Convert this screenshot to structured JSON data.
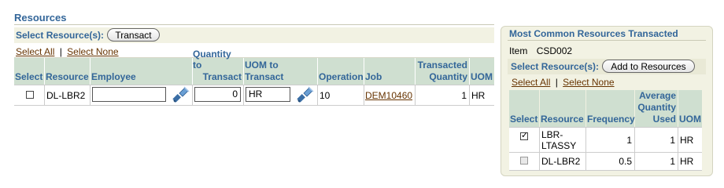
{
  "resources": {
    "title": "Resources",
    "select_label": "Select Resource(s):",
    "transact_button": "Transact",
    "select_all": "Select All",
    "separator": "|",
    "select_none": "Select None",
    "columns": {
      "select": "Select",
      "resource": "Resource",
      "employee": "Employee",
      "quantity_1": "Quantity to",
      "quantity_2": "Transact",
      "uom_1": "UOM to",
      "uom_2": "Transact",
      "operation": "Operation",
      "job": "Job",
      "transacted_1": "Transacted",
      "transacted_2": "Quantity",
      "uom": "UOM"
    },
    "row": {
      "checked": false,
      "resource": "DL-LBR2",
      "employee": "",
      "quantity": "0",
      "uom_to_transact": "HR",
      "operation": "10",
      "job": "DEM10460",
      "transacted_quantity": "1",
      "uom": "HR"
    },
    "icons": [
      "flashlight-search-icon",
      "flashlight-search-icon"
    ]
  },
  "most_common": {
    "title": "Most Common Resources Transacted",
    "item_label": "Item",
    "item_value": "CSD002",
    "select_label": "Select Resource(s):",
    "add_button": "Add to Resources",
    "select_all": "Select All",
    "separator": "|",
    "select_none": "Select None",
    "columns": {
      "select": "Select",
      "resource": "Resource",
      "frequency": "Frequency",
      "avg_1": "Average",
      "avg_2": "Quantity",
      "avg_3": "Used",
      "uom": "UOM"
    },
    "rows": [
      {
        "checked": true,
        "disabled": false,
        "resource_1": "LBR-",
        "resource_2": "LTASSY",
        "frequency": "1",
        "avg_used": "1",
        "uom": "HR"
      },
      {
        "checked": false,
        "disabled": true,
        "resource_1": "DL-LBR2",
        "resource_2": "",
        "frequency": "0.5",
        "avg_used": "1",
        "uom": "HR"
      }
    ]
  },
  "colors": {
    "heading": "#336699",
    "link": "#663300",
    "header_bg": "#cfdfd0",
    "bar_bg": "#f2f2e3"
  }
}
